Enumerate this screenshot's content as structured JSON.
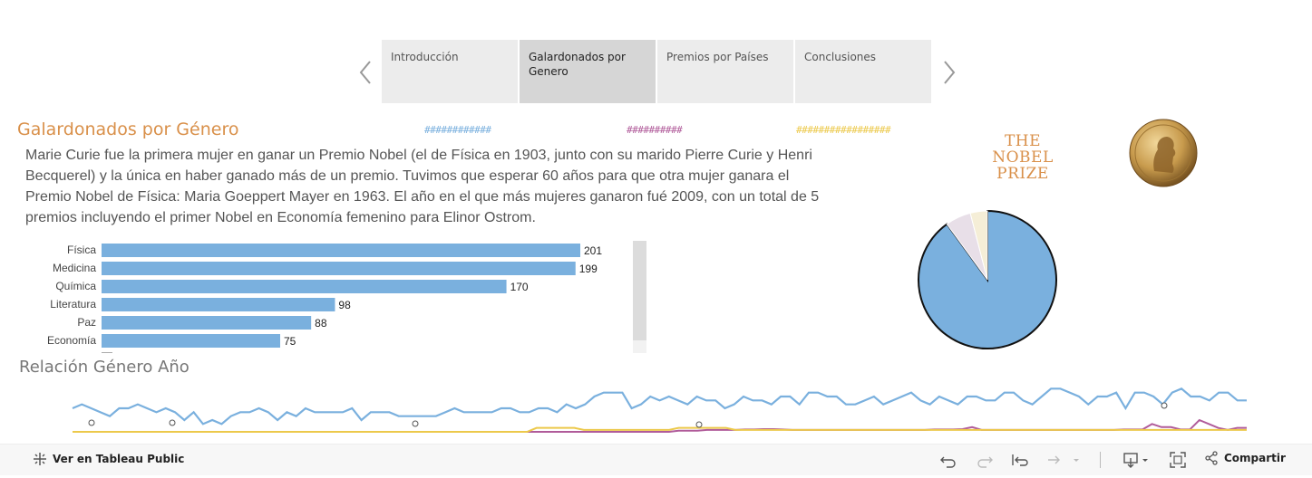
{
  "story": {
    "tabs": [
      {
        "label": "Introducción",
        "active": false
      },
      {
        "label": "Galardonados por Genero",
        "active": true
      },
      {
        "label": "Premios por Países",
        "active": false
      },
      {
        "label": "Conclusiones",
        "active": false
      }
    ]
  },
  "page": {
    "title": "Galardonados por Género",
    "legend": [
      "############",
      "##########",
      "#################"
    ],
    "intro": "Marie Curie fue la primera mujer en ganar un Premio Nobel (el de Física en 1903, junto con su marido Pierre Curie y Henri Becquerel) y la única en haber ganado más de un premio. Tuvimos que esperar 60 años para que otra mujer ganara el Premio Nobel de Física: Maria Goeppert Mayer en 1963. El año en el que más mujeres ganaron fué 2009, con un total de 5 premios incluyendo el primer Nobel en Economía femenino para Elinor Ostrom.",
    "logo_lines": [
      "THE",
      "NOBEL",
      "PRIZE"
    ],
    "line_title": "Relación Género Año"
  },
  "colors": {
    "accent": "#d9904a",
    "male": "#7ab0de",
    "female": "#b05b9a",
    "org": "#ecc94b"
  },
  "chart_data": [
    {
      "type": "bar",
      "categories": [
        "Física",
        "Medicina",
        "Química",
        "Literatura",
        "Paz",
        "Economía"
      ],
      "values": [
        201,
        199,
        170,
        98,
        88,
        75
      ],
      "title": "",
      "xlabel": "",
      "ylabel": "",
      "grid": false
    },
    {
      "type": "pie",
      "series": [
        {
          "share": 0.9,
          "color": "#7ab0de"
        },
        {
          "share": 0.06,
          "color": "#e8dfe8"
        },
        {
          "share": 0.04,
          "color": "#f5eed7"
        }
      ]
    },
    {
      "type": "line",
      "title": "Relación Género Año",
      "series": [
        {
          "color": "#7ab0de",
          "values": [
            6,
            7,
            6,
            5,
            4,
            6,
            6,
            7,
            6,
            5,
            6,
            5,
            3,
            5,
            2,
            3,
            2,
            4,
            5,
            5,
            6,
            5,
            3,
            5,
            4,
            6,
            5,
            5,
            5,
            5,
            6,
            3,
            5,
            5,
            5,
            4,
            4,
            4,
            4,
            4,
            5,
            6,
            5,
            5,
            5,
            5,
            6,
            6,
            5,
            5,
            6,
            6,
            5,
            7,
            6,
            7,
            9,
            10,
            10,
            10,
            6,
            7,
            9,
            8,
            9,
            8,
            7,
            9,
            8,
            8,
            6,
            7,
            9,
            8,
            8,
            7,
            9,
            9,
            7,
            10,
            10,
            9,
            9,
            7,
            7,
            8,
            9,
            7,
            8,
            9,
            10,
            8,
            7,
            9,
            8,
            7,
            9,
            9,
            8,
            8,
            10,
            10,
            8,
            7,
            9,
            11,
            11,
            10,
            9,
            7,
            9,
            9,
            10,
            6,
            10,
            10,
            9,
            7,
            10,
            11,
            9,
            9,
            8,
            10,
            10,
            8,
            8
          ]
        },
        {
          "color": "#b05b9a",
          "values": [
            0,
            0,
            0,
            0,
            0,
            0,
            0,
            0,
            0,
            0,
            0,
            0,
            0,
            0,
            0,
            0,
            0,
            0,
            0,
            0,
            0,
            0,
            0,
            0,
            0,
            0,
            0,
            0,
            0,
            0,
            0,
            0,
            0,
            0,
            0,
            0,
            0,
            0,
            0,
            0,
            0,
            0,
            0,
            0,
            0,
            0,
            0,
            0,
            0,
            0,
            0,
            0,
            0,
            0,
            0,
            0,
            0,
            0,
            0,
            0,
            0,
            0,
            0,
            0,
            0.3,
            0.3,
            0.3,
            0.5,
            0.5,
            0.5,
            0.5,
            0.6,
            0.6,
            0.7,
            0.7,
            0.6,
            0.5,
            0.5,
            0.5,
            0.5,
            0.5,
            0.5,
            0.5,
            0.5,
            0.5,
            0.5,
            0.5,
            0.5,
            0.5,
            0.5,
            0.5,
            0.6,
            0.6,
            0.6,
            0.7,
            1.2,
            0.5,
            0.5,
            0.5,
            0.5,
            0.5,
            0.5,
            0.5,
            0.5,
            0.5,
            0.5,
            0.5,
            0.5,
            0.5,
            0.5,
            0.5,
            0.6,
            0.6,
            0.6,
            2,
            1.2,
            1.2,
            0.6,
            0.6,
            3,
            2,
            1,
            0.5,
            1,
            1
          ]
        },
        {
          "color": "#ecc94b",
          "values": [
            0,
            0,
            0,
            0,
            0,
            0,
            0,
            0,
            0,
            0,
            0,
            0,
            0,
            0,
            0,
            0,
            0,
            0,
            0,
            0,
            0,
            0,
            0,
            0,
            0,
            0,
            0,
            0,
            0,
            0,
            0,
            0,
            0,
            0,
            0,
            0,
            0,
            0,
            0,
            0,
            0,
            0,
            0,
            0,
            0,
            0,
            0,
            0,
            0,
            1,
            1,
            1,
            1,
            1,
            0.5,
            0.5,
            0.5,
            0.5,
            0.5,
            0.5,
            0.5,
            0.5,
            0.5,
            0.5,
            1,
            1,
            1,
            1,
            1,
            1,
            0.5,
            0.5,
            0.5,
            0.5,
            0.5,
            0.5,
            0.5,
            0.5,
            0.5,
            0.5,
            0.5,
            0.5,
            0.5,
            0.5,
            0.5,
            0.5,
            0.5,
            0.5,
            0.5,
            0.5,
            0.5,
            0.5,
            0.5,
            0.5,
            0.5,
            0.5,
            0.5,
            0.5,
            0.5,
            0.5,
            0.5,
            0.5,
            0.5,
            0.5,
            0.5,
            0.5,
            0.5,
            0.5,
            0.5,
            0.5,
            0.5,
            0.5,
            0.5,
            0.5,
            0.5,
            0.5,
            0.5,
            0.5,
            0.5,
            0.5,
            0.5,
            0.5,
            0.5,
            0.5,
            0.5
          ]
        }
      ]
    }
  ],
  "toolbar": {
    "view_public": "Ver en Tableau Public",
    "share": "Compartir"
  }
}
